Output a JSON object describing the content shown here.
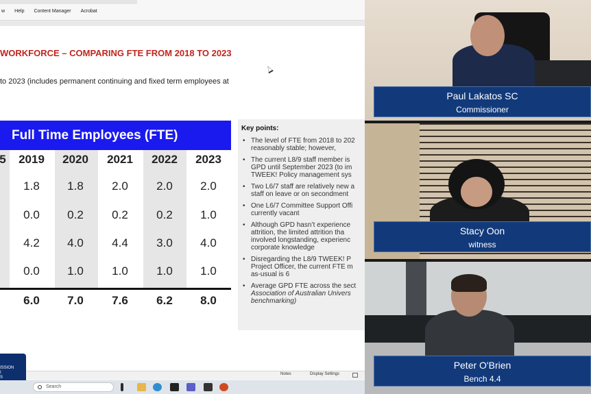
{
  "ribbon": {
    "menu": [
      "w",
      "Help",
      "Content Manager",
      "Acrobat"
    ]
  },
  "slide": {
    "title": "WORKFORCE – COMPARING FTE FROM 2018 TO 2023",
    "subtitle": "to 2023 (includes permanent continuing and fixed term employees at",
    "table_header": "Full Time Employees (FTE)",
    "columns": [
      "2019",
      "2020",
      "2021",
      "2022",
      "2023"
    ],
    "rows": [
      [
        "1.8",
        "1.8",
        "2.0",
        "2.0",
        "2.0"
      ],
      [
        "0.0",
        "0.2",
        "0.2",
        "0.2",
        "1.0"
      ],
      [
        "4.2",
        "4.0",
        "4.4",
        "3.0",
        "4.0"
      ],
      [
        "0.0",
        "1.0",
        "1.0",
        "1.0",
        "1.0"
      ]
    ],
    "totals": [
      "6.0",
      "7.0",
      "7.6",
      "6.2",
      "8.0"
    ],
    "key_points_title": "Key points:",
    "key_points": [
      [
        "The level of FTE from 2018 to 202",
        "reasonably stable; however,"
      ],
      [
        "The current L8/9 staff member is",
        "GPD until September 2023 (to im",
        "TWEEK! Policy management sys"
      ],
      [
        "Two L6/7 staff are relatively new a",
        "staff on leave or on secondment"
      ],
      [
        "One L6/7 Committee Support Offi",
        "currently vacant"
      ],
      [
        "Although GPD hasn’t experience",
        "attrition, the limited attrition tha",
        "involved longstanding, experienc",
        "corporate knowledge"
      ],
      [
        "Disregarding the L8/9 TWEEK! P",
        "Project Officer, the current FTE m",
        "as-usual is 6"
      ],
      [
        "Average GPD FTE across the sect",
        "Association of Australian Univers",
        "benchmarking)"
      ]
    ]
  },
  "status": {
    "notes": "Notes",
    "display_settings": "Display Settings"
  },
  "badge": {
    "lines": [
      "ISSION",
      "I",
      "S"
    ]
  },
  "taskbar": {
    "search_placeholder": "Search"
  },
  "participants": [
    {
      "name": "Paul Lakatos SC",
      "role": "Commissioner"
    },
    {
      "name": "Stacy Oon",
      "role": "witness"
    },
    {
      "name": "Peter O'Brien",
      "role": "Bench 4.4"
    }
  ],
  "colors": {
    "title_red": "#c0251e",
    "table_header_blue": "#1a1aef",
    "panel_blue": "#123a7b"
  }
}
